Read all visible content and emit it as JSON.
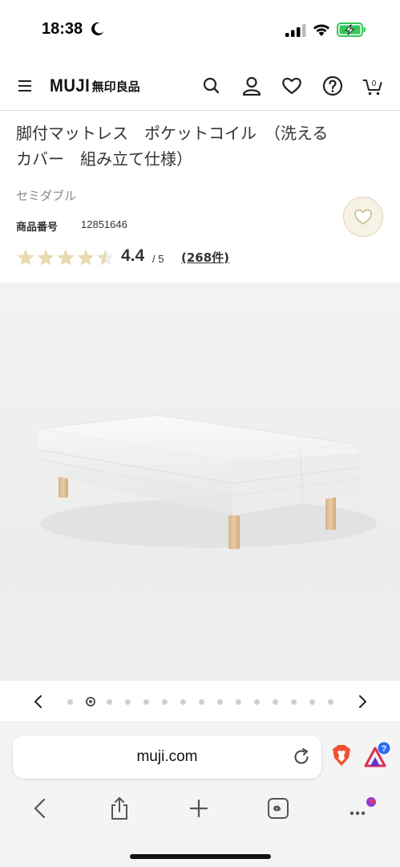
{
  "status_bar": {
    "time": "18:38",
    "icons": [
      "moon-icon",
      "cellular-signal-icon",
      "wifi-icon",
      "battery-charging-icon"
    ]
  },
  "header": {
    "logo_en": "MUJI",
    "logo_ja": "無印良品",
    "icons": [
      "menu-icon",
      "search-icon",
      "account-icon",
      "favorites-icon",
      "help-icon",
      "cart-icon"
    ],
    "cart_count": "0"
  },
  "product": {
    "title": "脚付マットレス　ポケットコイル　（洗える\nカバー　組み立て仕様）",
    "variant": "セミダブル",
    "number_label": "商品番号",
    "number_value": "12851646",
    "rating": "4.4",
    "rating_max": "/ 5",
    "rating_value": 4.4,
    "review_count": "(268件)",
    "accent_color": "#e0d3b0",
    "star_color": "#e8d9b0"
  },
  "gallery": {
    "image": "mattress-with-legs-image",
    "dot_count": 15,
    "active_index": 1
  },
  "browser": {
    "url": "muji.com",
    "icons": [
      "reload-icon",
      "brave-shield-icon",
      "brave-rewards-icon",
      "back-icon",
      "share-icon",
      "new-tab-icon",
      "tabs-icon",
      "more-icon"
    ],
    "rewards_badge": "?"
  }
}
